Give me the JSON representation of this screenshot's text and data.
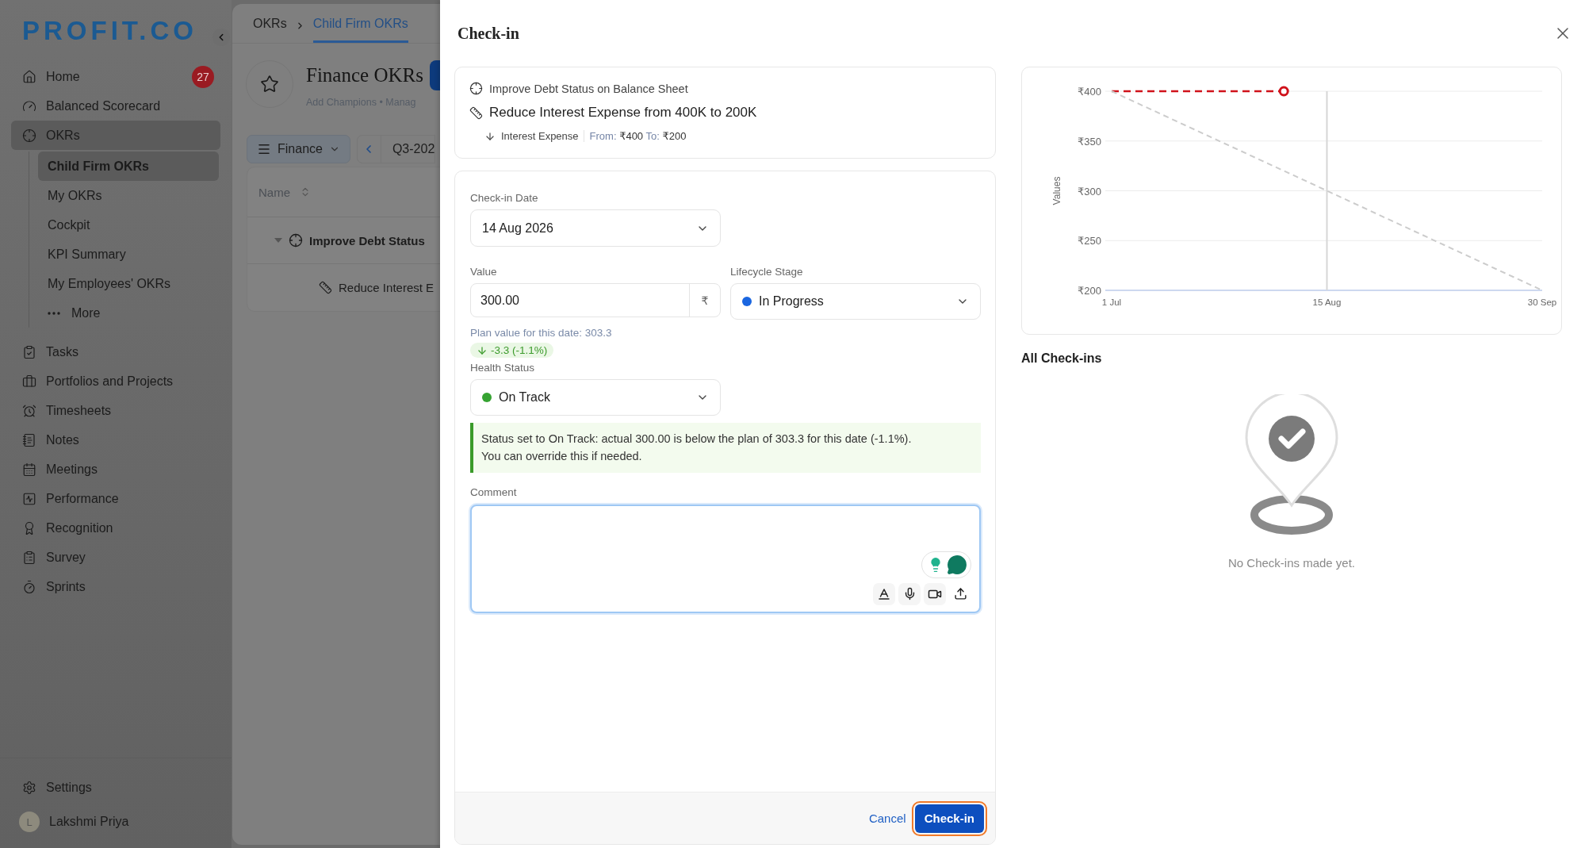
{
  "sidebar": {
    "logo": "PROFIT.CO",
    "nav": [
      {
        "label": "Home",
        "badge": "27",
        "selected": false
      },
      {
        "label": "Balanced Scorecard",
        "selected": false
      },
      {
        "label": "OKRs",
        "selected": true,
        "children": [
          {
            "label": "Child Firm OKRs",
            "kind": "link",
            "selected": true
          },
          {
            "label": "My OKRs",
            "kind": "link",
            "selected": false
          },
          {
            "label": "Cockpit",
            "kind": "link",
            "selected": false
          },
          {
            "label": "KPI Summary",
            "kind": "link",
            "selected": false
          },
          {
            "label": "My Employees' OKRs",
            "kind": "link",
            "selected": false
          },
          {
            "label": "More",
            "kind": "more",
            "selected": false
          }
        ]
      },
      {
        "label": "Tasks",
        "selected": false
      },
      {
        "label": "Portfolios and Projects",
        "selected": false
      },
      {
        "label": "Timesheets",
        "selected": false
      },
      {
        "label": "Notes",
        "selected": false
      },
      {
        "label": "Meetings",
        "selected": false
      },
      {
        "label": "Performance",
        "selected": false
      },
      {
        "label": "Recognition",
        "selected": false
      },
      {
        "label": "Survey",
        "selected": false
      },
      {
        "label": "Sprints",
        "selected": false
      }
    ],
    "settings": "Settings",
    "user": {
      "name": "Lakshmi Priya",
      "initial": "L"
    }
  },
  "main": {
    "breadcrumb": [
      {
        "label": "OKRs",
        "selected": false
      },
      {
        "label": "Child Firm OKRs",
        "selected": true
      }
    ],
    "header": {
      "title": "Finance OKRs",
      "links": "Add Champions • Manag"
    },
    "toolbar": {
      "filter": "Finance",
      "period": "Q3-202"
    },
    "table": {
      "columns": [
        "Name"
      ],
      "rows": [
        {
          "name": "Improve Debt Status",
          "expanded": true,
          "children": [
            {
              "name": "Reduce Interest E"
            }
          ]
        }
      ]
    }
  },
  "dialog": {
    "title": "Check-in",
    "objective": "Improve Debt Status on Balance Sheet",
    "key_result": "Reduce Interest Expense from 400K to 200K",
    "metric": {
      "name": "Interest Expense",
      "from_label": "From:",
      "from": "₹400",
      "to_label": "To:",
      "to": "₹200"
    },
    "form": {
      "date": {
        "label": "Check-in Date",
        "value": "14 Aug 2026"
      },
      "value": {
        "label": "Value",
        "value": "300.00",
        "unit": "₹"
      },
      "lifecycle": {
        "label": "Lifecycle Stage",
        "value": "In Progress",
        "color": "#1a66e0"
      },
      "plan_note": "Plan value for this date: 303.3",
      "delta": {
        "text": "-3.3 (-1.1%)"
      },
      "health": {
        "label": "Health Status",
        "value": "On Track",
        "color": "#36a332"
      },
      "notice": [
        "Status set to On Track: actual 300.00 is below the plan of 303.3 for this date (-1.1%).",
        "You can override this if needed."
      ],
      "comment": {
        "label": "Comment",
        "focused": true
      }
    },
    "footer": {
      "cancel": "Cancel",
      "submit": {
        "label": "Check-in",
        "focused": true
      }
    },
    "chart": {
      "chart_data": {
        "type": "line",
        "ylabel": "Values",
        "categories": [
          "1 Jul",
          null,
          null,
          null,
          null,
          null,
          null,
          null,
          null,
          null,
          "15 Aug",
          null,
          null,
          null,
          null,
          null,
          null,
          null,
          null,
          null,
          "30 Sep"
        ],
        "grid": true,
        "series": [
          {
            "color": "#d0121b",
            "line_style": "dashed",
            "values": [
              400,
              400,
              400,
              400,
              400,
              400,
              400,
              400,
              400,
              null,
              null,
              null,
              null,
              null,
              null,
              null,
              null,
              null,
              null,
              null,
              null
            ]
          },
          {
            "color": "#cccccc",
            "line_style": "dashed",
            "values": [
              400,
              390,
              380,
              370,
              360,
              350,
              340,
              330,
              320,
              310,
              300,
              290,
              280,
              270,
              260,
              250,
              240,
              230,
              220,
              210,
              200
            ]
          }
        ],
        "ylim": [
          200,
          400
        ],
        "yticks": [
          {
            "value": 400,
            "label": "₹400"
          },
          {
            "value": 350,
            "label": "₹350"
          },
          {
            "value": 300,
            "label": "₹300"
          },
          {
            "value": 250,
            "label": "₹250"
          },
          {
            "value": 200,
            "label": "₹200"
          }
        ],
        "ref_lines": [
          {
            "axis": "x",
            "value": "15 Aug"
          }
        ]
      }
    },
    "history": {
      "title": "All Check-ins",
      "empty": "No Check-ins made yet."
    }
  }
}
